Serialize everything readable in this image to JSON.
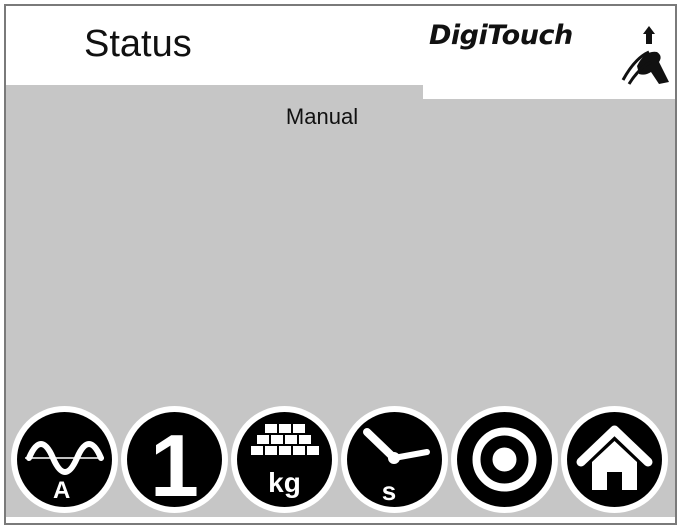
{
  "header": {
    "title": "Status",
    "logo_text": "DigiTouch"
  },
  "main": {
    "mode": "Manual"
  },
  "toolbar": {
    "buttons": [
      {
        "name": "analog-output-button",
        "icon": "sine-wave-icon",
        "label": "A"
      },
      {
        "name": "one-button",
        "icon": "number-one-icon",
        "label": "1"
      },
      {
        "name": "weight-button",
        "icon": "bricks-icon",
        "label": "kg"
      },
      {
        "name": "time-button",
        "icon": "clock-icon",
        "label": "s"
      },
      {
        "name": "record-button",
        "icon": "target-icon",
        "label": ""
      },
      {
        "name": "home-button",
        "icon": "home-icon",
        "label": ""
      }
    ]
  },
  "colors": {
    "panel_background": "#c6c6c6",
    "frame_border": "#7a7a7a",
    "header_background": "#ffffff",
    "icon_disc": "#000000",
    "icon_glyph": "#ffffff"
  }
}
